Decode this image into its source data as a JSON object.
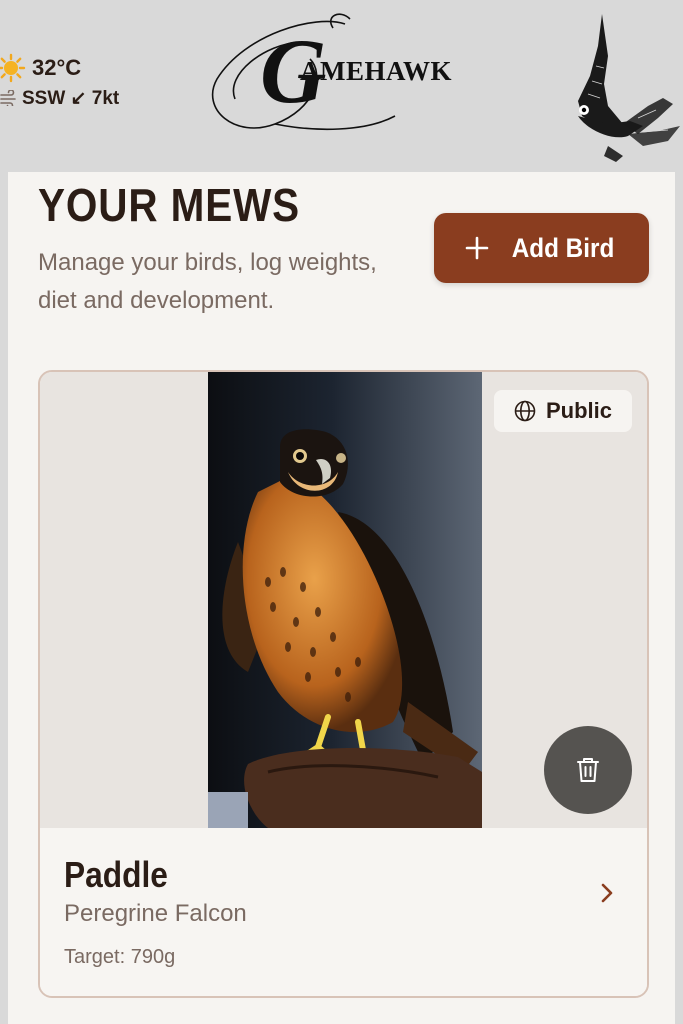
{
  "header": {
    "weather": {
      "temperature": "32°C",
      "wind": "SSW ↙ 7kt",
      "icons": [
        "sun-icon",
        "wind-icon"
      ]
    },
    "logo_text": "AMEHAWK",
    "logo_initial": "G"
  },
  "page": {
    "title": "YOUR MEWS",
    "subtitle": "Manage your birds, log weights, diet and development.",
    "add_button_label": "Add Bird"
  },
  "birds": [
    {
      "visibility": "Public",
      "name": "Paddle",
      "species": "Peregrine Falcon",
      "target": "Target: 790g"
    }
  ],
  "colors": {
    "accent": "#8a3d1f",
    "text_dark": "#2b1d16",
    "text_muted": "#7a6a62",
    "header_bg": "#d9d9d9",
    "card_border": "#d8c3b7"
  }
}
